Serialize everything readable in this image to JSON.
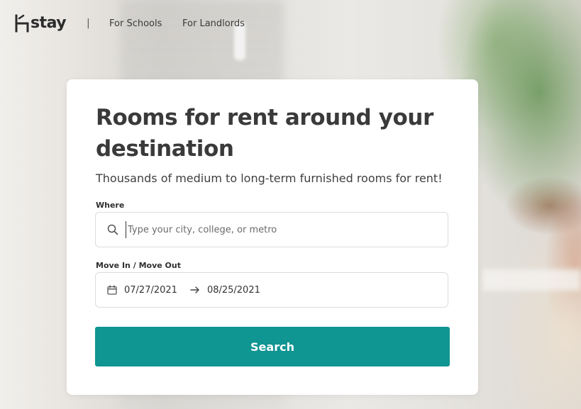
{
  "header": {
    "logo_text": "stay",
    "separator": "|",
    "nav": {
      "schools": "For Schools",
      "landlords": "For Landlords"
    }
  },
  "hero": {
    "title": "Rooms for rent around your destination",
    "subtitle": "Thousands of medium to long-term furnished rooms for rent!"
  },
  "form": {
    "where_label": "Where",
    "where_placeholder": "Type your city, college, or metro",
    "where_value": "",
    "dates_label": "Move In / Move Out",
    "move_in": "07/27/2021",
    "move_out": "08/25/2021",
    "search_label": "Search"
  },
  "icons": {
    "logo": "hstay-logo-icon",
    "search": "search-icon",
    "calendar": "calendar-icon",
    "arrow": "arrow-right-icon"
  },
  "colors": {
    "accent": "#0f9592",
    "text": "#3a3a3a",
    "card": "#ffffff"
  }
}
